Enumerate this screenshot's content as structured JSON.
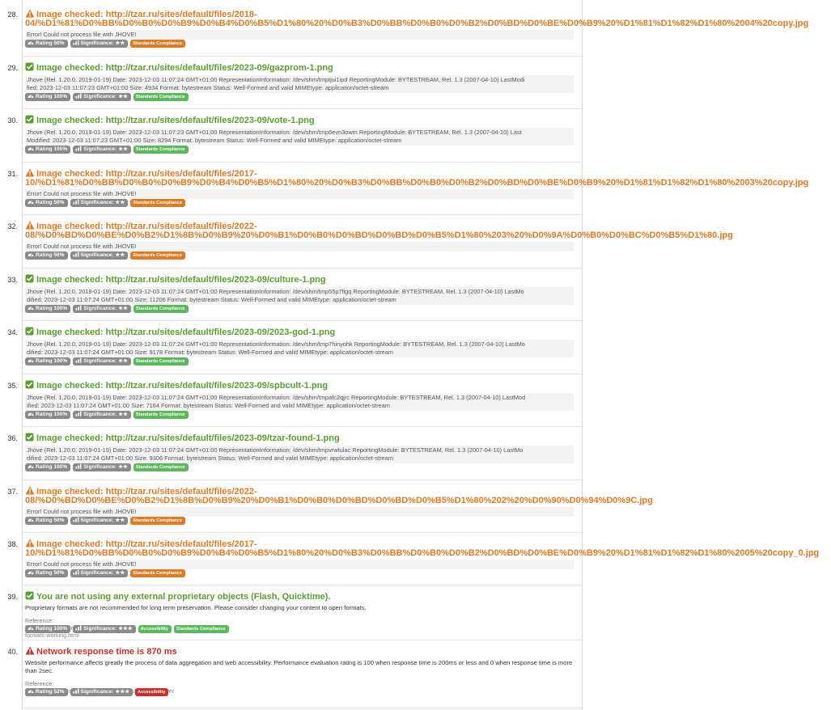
{
  "entries": [
    {
      "num": "28.",
      "status": "warn",
      "title": "Image checked: http://tzar.ru/sites/default/files/2018-",
      "title2": "04/%D1%81%D0%BB%D0%B0%D0%B9%D0%B4%D0%B5%D1%80%20%D0%B3%D0%BB%D0%B0%D0%B2%D0%BD%D0%BE%D0%B9%20%D1%81%D1%82%D1%80%2004%20copy.jpg",
      "detail": [
        "Error! Could not process file with JHOVE!"
      ],
      "rating": "Rating 50%",
      "sig": "Significance: ★★",
      "tags": [
        {
          "t": "Standards Compliance",
          "c": "orange"
        }
      ]
    },
    {
      "num": "29.",
      "status": "ok",
      "title": "Image checked: http://tzar.ru/sites/default/files/2023-09/gazprom-1.png",
      "detail": [
        "Jhove (Rel. 1.20.0, 2019-01-19) Date: 2023-12-03 11:07:24 GMT+01:00 RepresentationInformation: /dev/shm/tmptjui1ipd ReportingModule: BYTESTREAM, Rel. 1.3 (2007-04-10) LastModi",
        "fied: 2023-12-03 11:07:23 GMT+01:00 Size: 4934 Format: bytestream Status: Well-Formed and valid MIMEtype: application/octet-stream"
      ],
      "rating": "Rating 100%",
      "sig": "Significance: ★★",
      "tags": [
        {
          "t": "Standards Compliance",
          "c": "green"
        }
      ]
    },
    {
      "num": "30.",
      "status": "ok",
      "title": "Image checked: http://tzar.ru/sites/default/files/2023-09/vote-1.png",
      "detail": [
        "Jhove (Rel. 1.20.0, 2019-01-19) Date: 2023-12-03 11:07:23 GMT+01:00 RepresentationInformation: /dev/shm/tmp6evn3owm ReportingModule: BYTESTREAM, Rel. 1.3 (2007-04-10) Last",
        "Modified: 2023-12-03 11:07:23 GMT+01:00 Size: 8294 Format: bytestream Status: Well-Formed and valid MIMEtype: application/octet-stream"
      ],
      "rating": "Rating 100%",
      "sig": "Significance: ★★",
      "tags": [
        {
          "t": "Standards Compliance",
          "c": "green"
        }
      ]
    },
    {
      "num": "31.",
      "status": "warn",
      "title": "Image checked: http://tzar.ru/sites/default/files/2017-",
      "title2": "10/%D1%81%D0%BB%D0%B0%D0%B9%D0%B4%D0%B5%D1%80%20%D0%B3%D0%BB%D0%B0%D0%B2%D0%BD%D0%BE%D0%B9%20%D1%81%D1%82%D1%80%2003%20copy.jpg",
      "detail": [
        "Error! Could not process file with JHOVE!"
      ],
      "rating": "Rating 50%",
      "sig": "Significance: ★★",
      "tags": [
        {
          "t": "Standards Compliance",
          "c": "orange"
        }
      ]
    },
    {
      "num": "32.",
      "status": "warn",
      "title": "Image checked: http://tzar.ru/sites/default/files/2022-",
      "title2": "08/%D0%BD%D0%BE%D0%B2%D1%8B%D0%B9%20%D0%B1%D0%B0%D0%BD%D0%BD%D0%B5%D1%80%203%20%D0%9A%D0%B0%D0%BC%D0%B5%D1%80.jpg",
      "detail": [
        "Error! Could not process file with JHOVE!"
      ],
      "rating": "Rating 50%",
      "sig": "Significance: ★★",
      "tags": [
        {
          "t": "Standards Compliance",
          "c": "orange"
        }
      ]
    },
    {
      "num": "33.",
      "status": "ok",
      "title": "Image checked: http://tzar.ru/sites/default/files/2023-09/culture-1.png",
      "detail": [
        "Jhove (Rel. 1.20.0, 2019-01-19) Date: 2023-12-03 11:07:24 GMT+01:00 RepresentationInformation: /dev/shm/tmp55p7figq ReportingModule: BYTESTREAM, Rel. 1.3 (2007-04-10) LastMo",
        "dified: 2023-12-03 11:07:24 GMT+01:00 Size: 11206 Format: bytestream Status: Well-Formed and valid MIMEtype: application/octet-stream"
      ],
      "rating": "Rating 100%",
      "sig": "Significance: ★★",
      "tags": [
        {
          "t": "Standards Compliance",
          "c": "green"
        }
      ]
    },
    {
      "num": "34.",
      "status": "ok",
      "title": "Image checked: http://tzar.ru/sites/default/files/2023-09/2023-god-1.png",
      "detail": [
        "Jhove (Rel. 1.20.0, 2019-01-19) Date: 2023-12-03 11:07:24 GMT+01:00 RepresentationInformation: /dev/shm/tmp7hinyohk ReportingModule: BYTESTREAM, Rel. 1.3 (2007-04-10) LastMo",
        "dified: 2023-12-03 11:07:24 GMT+01:00 Size: 9178 Format: bytestream Status: Well-Formed and valid MIMEtype: application/octet-stream"
      ],
      "rating": "Rating 100%",
      "sig": "Significance: ★★",
      "tags": [
        {
          "t": "Standards Compliance",
          "c": "green"
        }
      ]
    },
    {
      "num": "35.",
      "status": "ok",
      "title": "Image checked: http://tzar.ru/sites/default/files/2023-09/spbcult-1.png",
      "detail": [
        "Jhove (Rel. 1.20.0, 2019-01-19) Date: 2023-12-03 11:07:24 GMT+01:00 RepresentationInformation: /dev/shm/tmpafc2qjrc ReportingModule: BYTESTREAM, Rel. 1.3 (2007-04-10) LastMod",
        "ified: 2023-12-03 11:07:24 GMT+01:00 Size: 7164 Format: bytestream Status: Well-Formed and valid MIMEtype: application/octet-stream"
      ],
      "rating": "Rating 100%",
      "sig": "Significance: ★★",
      "tags": [
        {
          "t": "Standards Compliance",
          "c": "green"
        }
      ]
    },
    {
      "num": "36.",
      "status": "ok",
      "title": "Image checked: http://tzar.ru/sites/default/files/2023-09/tzar-found-1.png",
      "detail": [
        "Jhove (Rel. 1.20.0, 2019-01-19) Date: 2023-12-03 11:07:24 GMT+01:00 RepresentationInformation: /dev/shm/tmpvrwtulac ReportingModule: BYTESTREAM, Rel. 1.3 (2007-04-10) LastMo",
        "dified: 2023-12-03 11:07:24 GMT+01:00 Size: 9306 Format: bytestream Status: Well-Formed and valid MIMEtype: application/octet-stream"
      ],
      "rating": "Rating 100%",
      "sig": "Significance: ★★",
      "tags": [
        {
          "t": "Standards Compliance",
          "c": "green"
        }
      ]
    },
    {
      "num": "37.",
      "status": "warn",
      "title": "Image checked: http://tzar.ru/sites/default/files/2022-",
      "title2": "08/%D0%BD%D0%BE%D0%B2%D1%8B%D0%B9%20%D0%B1%D0%B0%D0%BD%D0%BD%D0%B5%D1%80%202%20%D0%90%D0%94%D0%9C.jpg",
      "detail": [
        "Error! Could not process file with JHOVE!"
      ],
      "rating": "Rating 50%",
      "sig": "Significance: ★★",
      "tags": [
        {
          "t": "Standards Compliance",
          "c": "orange"
        }
      ]
    },
    {
      "num": "38.",
      "status": "warn",
      "title": "Image checked: http://tzar.ru/sites/default/files/2017-",
      "title2": "10/%D1%81%D0%BB%D0%B0%D0%B9%D0%B4%D0%B5%D1%80%20%D0%B3%D0%BB%D0%B0%D0%B2%D0%BD%D0%BE%D0%B9%20%D1%81%D1%82%D1%80%2005%20copy_0.jpg",
      "detail": [
        "Error! Could not process file with JHOVE!"
      ],
      "rating": "Rating 50%",
      "sig": "Significance: ★★",
      "tags": [
        {
          "t": "Standards Compliance",
          "c": "orange"
        }
      ]
    },
    {
      "num": "39.",
      "status": "ok",
      "title": "You are not using any external proprietary objects (Flash, Quicktime).",
      "desc": "Proprietary formats are not recommended for long term preservation. Please consider changing your content to open formats.",
      "ref_label": "Reference:",
      "ref_url": "http://www.ands.org.au/guides/file-formats-working.html",
      "rating": "Rating 100%",
      "sig": "Significance: ★★★",
      "tags": [
        {
          "t": "Accessibility",
          "c": "green"
        },
        {
          "t": "Standards Compliance",
          "c": "green"
        }
      ]
    },
    {
      "num": "40.",
      "status": "err",
      "title": "Network response time is 870 ms",
      "desc": "Website performance affects greatly the process of data aggregation and web accessibility. Performance evaluation rating is 100 when response time is 200ms or less and 0 when response time is more than 2sec.",
      "ref_label": "Reference:",
      "ref_url": "https://developers.google.com/speed/docs/insights/Server",
      "rating": "Rating 52%",
      "sig": "Significance: ★★★",
      "tags": [
        {
          "t": "Accessibility",
          "c": "red"
        }
      ]
    }
  ],
  "colors": {
    "ok": "#5a9e2f",
    "warn": "#e07b24",
    "err": "#c9302c"
  }
}
